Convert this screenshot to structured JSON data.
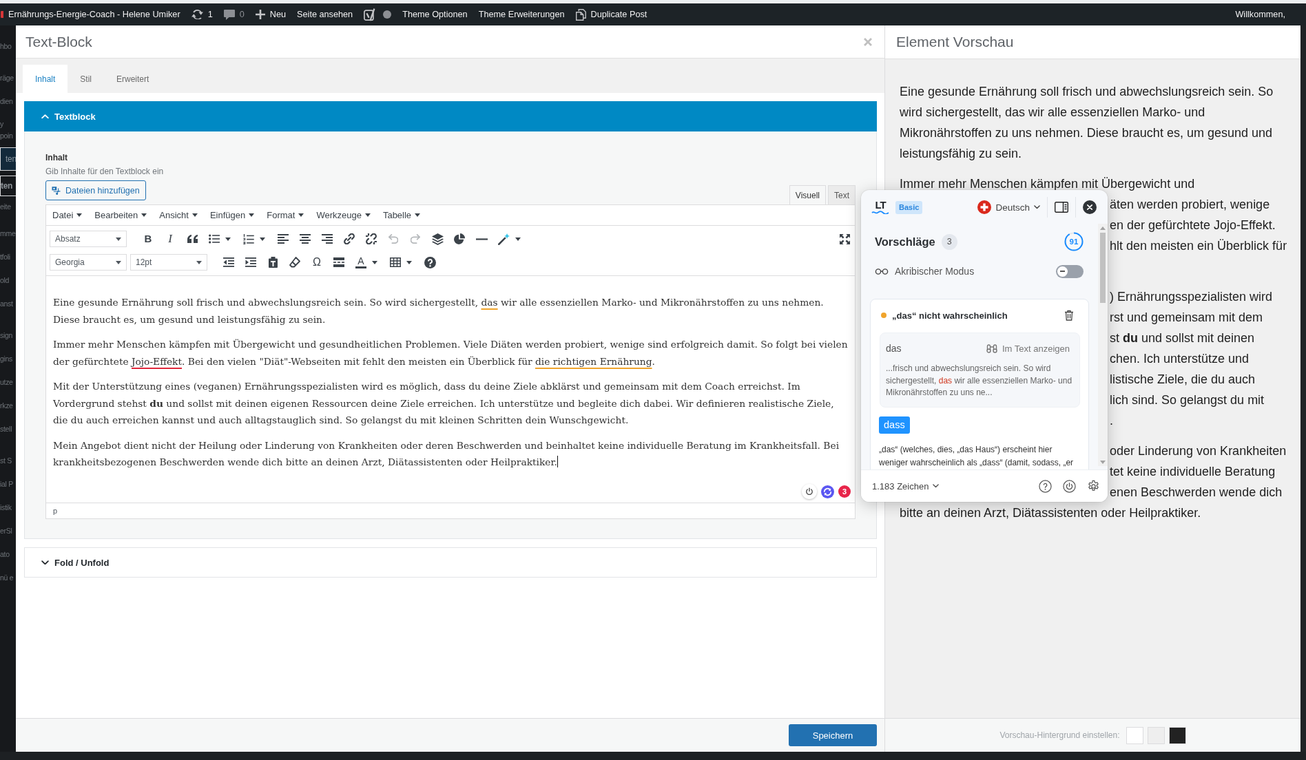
{
  "admin_bar": {
    "items": [
      {
        "kind": "site",
        "label": "Ernährungs-Energie-Coach - Helene Umiker"
      },
      {
        "kind": "updates",
        "label": "1"
      },
      {
        "kind": "comments",
        "label": "0"
      },
      {
        "kind": "new",
        "label": "Neu"
      },
      {
        "kind": "link",
        "label": "Seite ansehen"
      },
      {
        "kind": "seo"
      },
      {
        "kind": "link",
        "label": "Theme Optionen"
      },
      {
        "kind": "link",
        "label": "Theme Erweiterungen"
      },
      {
        "kind": "duplicate",
        "label": "Duplicate Post"
      }
    ],
    "greeting": "Willkommen,"
  },
  "background_menu": [
    {
      "kind": "menu",
      "label": "hbo",
      "selected": false
    },
    {
      "kind": "separator"
    },
    {
      "kind": "menu",
      "label": "räge",
      "selected": false
    },
    {
      "kind": "menu",
      "label": "dien",
      "selected": false
    },
    {
      "kind": "menu",
      "label": "y poin",
      "selected": false
    },
    {
      "kind": "menu",
      "label": "ten",
      "selected": true
    },
    {
      "kind": "submenu",
      "label": "ten",
      "selected": true
    },
    {
      "kind": "submenu",
      "label": "eite",
      "selected": false
    },
    {
      "kind": "menu",
      "label": "mme",
      "selected": false
    },
    {
      "kind": "menu",
      "label": "tfoli",
      "selected": false
    },
    {
      "kind": "menu",
      "label": "old",
      "selected": false
    },
    {
      "kind": "menu",
      "label": "anst",
      "selected": false
    },
    {
      "kind": "separator"
    },
    {
      "kind": "menu",
      "label": "sign",
      "selected": false
    },
    {
      "kind": "menu",
      "label": "gins",
      "selected": false
    },
    {
      "kind": "menu",
      "label": "utze",
      "selected": false
    },
    {
      "kind": "menu",
      "label": "rkze",
      "selected": false
    },
    {
      "kind": "menu",
      "label": "stell",
      "selected": false
    },
    {
      "kind": "separator"
    },
    {
      "kind": "menu",
      "label": "st S",
      "selected": false
    },
    {
      "kind": "menu",
      "label": "ial P",
      "selected": false
    },
    {
      "kind": "menu",
      "label": "istik",
      "selected": false
    },
    {
      "kind": "menu",
      "label": "erSl",
      "selected": false
    },
    {
      "kind": "menu",
      "label": "ato",
      "selected": false
    },
    {
      "kind": "menu",
      "label": "nü e",
      "selected": false
    }
  ],
  "editor_panel": {
    "title": "Text-Block",
    "tabs": [
      {
        "label": "Inhalt",
        "selected": true
      },
      {
        "label": "Stil",
        "selected": false
      },
      {
        "label": "Erweitert",
        "selected": false
      }
    ],
    "sections": [
      {
        "title": "Textblock",
        "expanded": true,
        "field": {
          "label": "Inhalt",
          "description": "Gib Inhalte für den Textblock ein",
          "media_button": "Dateien hinzufügen"
        },
        "editor": {
          "modes": [
            {
              "label": "Visuell",
              "selected": true
            },
            {
              "label": "Text",
              "selected": false
            }
          ],
          "menus": [
            "Datei",
            "Bearbeiten",
            "Ansicht",
            "Einfügen",
            "Format",
            "Werkzeuge",
            "Tabelle"
          ],
          "toolbar": [
            [
              {
                "kind": "select",
                "value": "Absatz",
                "dropdown": true,
                "disabled": false
              },
              {
                "kind": "bold",
                "glyph": "B",
                "dropdown": false,
                "disabled": false
              },
              {
                "kind": "italic",
                "glyph": "I",
                "dropdown": false,
                "disabled": false
              },
              {
                "kind": "quote",
                "dropdown": false,
                "disabled": false
              },
              {
                "kind": "bullets",
                "dropdown": true,
                "disabled": false
              },
              {
                "kind": "numbers",
                "dropdown": true,
                "disabled": false
              },
              {
                "kind": "align-left",
                "dropdown": false,
                "disabled": false
              },
              {
                "kind": "align-center",
                "dropdown": false,
                "disabled": false
              },
              {
                "kind": "align-right",
                "dropdown": false,
                "disabled": false
              },
              {
                "kind": "link",
                "dropdown": false,
                "disabled": false
              },
              {
                "kind": "unlink",
                "dropdown": false,
                "disabled": false
              },
              {
                "kind": "undo",
                "dropdown": false,
                "disabled": true
              },
              {
                "kind": "redo",
                "dropdown": false,
                "disabled": true
              },
              {
                "kind": "layers",
                "dropdown": false,
                "disabled": false
              },
              {
                "kind": "pie",
                "dropdown": false,
                "disabled": false
              },
              {
                "kind": "rule",
                "dropdown": false,
                "disabled": false
              },
              {
                "kind": "wand",
                "dropdown": true,
                "disabled": false
              },
              {
                "kind": "fullscreen",
                "dropdown": false,
                "disabled": false
              }
            ],
            [
              {
                "kind": "select",
                "value": "Georgia",
                "dropdown": true,
                "disabled": false
              },
              {
                "kind": "select",
                "value": "12pt",
                "dropdown": true,
                "disabled": false
              },
              {
                "kind": "outdent",
                "dropdown": false,
                "disabled": false
              },
              {
                "kind": "indent",
                "dropdown": false,
                "disabled": false
              },
              {
                "kind": "paste",
                "dropdown": false,
                "disabled": false
              },
              {
                "kind": "eraser",
                "dropdown": false,
                "disabled": false
              },
              {
                "kind": "symbol",
                "glyph": "Ω",
                "dropdown": false,
                "disabled": false
              },
              {
                "kind": "readmore",
                "dropdown": false,
                "disabled": false
              },
              {
                "kind": "text-color",
                "glyph": "A",
                "dropdown": true,
                "disabled": false
              },
              {
                "kind": "table",
                "dropdown": true,
                "disabled": false
              },
              {
                "kind": "help",
                "dropdown": false,
                "disabled": false
              }
            ]
          ],
          "paragraphs": [
            {
              "cursor": false,
              "segments": [
                {
                  "kind": "plain",
                  "text": "Eine gesunde Ernährung soll frisch und abwechslungsreich sein. So wird sichergestellt, "
                },
                {
                  "kind": "grammar",
                  "text": "das"
                },
                {
                  "kind": "plain",
                  "text": " wir alle essenziellen Marko- und Mikronährstoffen zu uns nehmen. Diese braucht es, um gesund und leistungsfähig zu sein."
                }
              ]
            },
            {
              "cursor": false,
              "segments": [
                {
                  "kind": "plain",
                  "text": "Immer mehr Menschen kämpfen mit Übergewicht und gesundheitlichen Problemen. Viele Diäten werden probiert, wenige sind erfolgreich damit. So folgt bei vielen der gefürchtete "
                },
                {
                  "kind": "spelling",
                  "text": "Jojo-Effekt"
                },
                {
                  "kind": "plain",
                  "text": ". Bei den vielen \"Diät\"-Webseiten mit fehlt den meisten ein Überblick für "
                },
                {
                  "kind": "grammar",
                  "text": "die richtigen Ernährung"
                },
                {
                  "kind": "plain",
                  "text": "."
                }
              ]
            },
            {
              "cursor": false,
              "segments": [
                {
                  "kind": "plain",
                  "text": "Mit der Unterstützung eines (veganen) Ernährungsspezialisten wird es möglich, dass du deine Ziele abklärst und gemeinsam mit dem Coach erreichst. Im Vordergrund stehst **du** und sollst mit deinen eigenen Ressourcen deine Ziele erreichen. Ich unterstütze und begleite dich dabei. Wir definieren realistische Ziele, die du auch erreichen kannst und auch alltagstauglich sind. So gelangst du mit kleinen Schritten dein Wunschgewicht."
                }
              ]
            },
            {
              "cursor": true,
              "segments": [
                {
                  "kind": "plain",
                  "text": "Mein Angebot dient nicht der Heilung oder Linderung von Krankheiten oder deren Beschwerden und beinhaltet keine individuelle Beratung im Krankheitsfall. Bei krankheitsbezogenen Beschwerden wende dich bitte an deinen Arzt, Diätassistenten oder Heilpraktiker."
                }
              ]
            }
          ],
          "path": "p",
          "issue_count": "3"
        }
      },
      {
        "title": "Fold / Unfold",
        "expanded": false
      }
    ],
    "save_button": "Speichern"
  },
  "preview_panel": {
    "title": "Element Vorschau",
    "paragraphs": [
      {
        "lines": [
          {
            "kind": "full",
            "text": "Eine gesunde Ernährung soll frisch und abwechslungsreich sein. So"
          },
          {
            "kind": "full",
            "text": "wird sichergestellt, das wir alle essenziellen Marko- und"
          },
          {
            "kind": "full",
            "text": "Mikronährstoffen zu uns nehmen. Diese braucht es, um gesund und"
          },
          {
            "kind": "full",
            "text": "leistungsfähig zu sein."
          }
        ]
      },
      {
        "lines": [
          {
            "kind": "full",
            "text": "Immer mehr Menschen kämpfen mit Übergewicht und"
          },
          {
            "kind": "tail",
            "text": "äten werden probiert, wenige"
          },
          {
            "kind": "tail",
            "text": "en der gefürchtete Jojo-Effekt."
          },
          {
            "kind": "tail",
            "text": "hlt den meisten ein Überblick für"
          },
          {
            "kind": "hidden"
          }
        ]
      },
      {
        "lines": [
          {
            "kind": "tail",
            "text": ") Ernährungsspezialisten wird"
          },
          {
            "kind": "tail",
            "text": "rst und gemeinsam mit dem"
          },
          {
            "kind": "tail",
            "text": "st **du** und sollst mit deinen"
          },
          {
            "kind": "tail",
            "text": "chen. Ich unterstütze und"
          },
          {
            "kind": "tail",
            "text": "listische Ziele, die du auch"
          },
          {
            "kind": "tail",
            "text": "lich sind. So gelangst du mit"
          },
          {
            "kind": "tail",
            "text": "."
          }
        ]
      },
      {
        "lines": [
          {
            "kind": "tail",
            "text": "oder Linderung von Krankheiten"
          },
          {
            "kind": "tail",
            "text": "tet keine individuelle Beratung"
          },
          {
            "kind": "tail",
            "text": "enen Beschwerden wende dich"
          },
          {
            "kind": "full",
            "text": "bitte an deinen Arzt, Diätassistenten oder Heilpraktiker."
          }
        ]
      }
    ],
    "background_label": "Vorschau-Hintergrund einstellen:",
    "backgrounds": [
      {
        "color": "#ffffff"
      },
      {
        "color": "#eeeeee"
      },
      {
        "color": "#222222"
      }
    ]
  },
  "checker_popup": {
    "logo": "LT",
    "plan": "Basic",
    "language": "Deutsch",
    "heading": "Vorschläge",
    "count": "3",
    "score": "91",
    "level": 0.91,
    "picky_mode": {
      "label": "Akribischer Modus",
      "on": false
    },
    "cards": [
      {
        "kind": "grammar",
        "title": "„das“ nicht wahrscheinlich",
        "original": "das",
        "show_link": "Im Text anzeigen",
        "context": "...frisch und abwechslungsreich sein. So wird sichergestellt, **das** wir alle essenziellen Marko- und Mikronährstoffen zu uns ne...",
        "suggestion": "dass",
        "explanation": "„das“ (welches, dies, „das Haus“) erscheint hier weniger wahrscheinlich als „dass“ (damit, sodass, „er"
      }
    ],
    "characters": "1.183 Zeichen"
  }
}
